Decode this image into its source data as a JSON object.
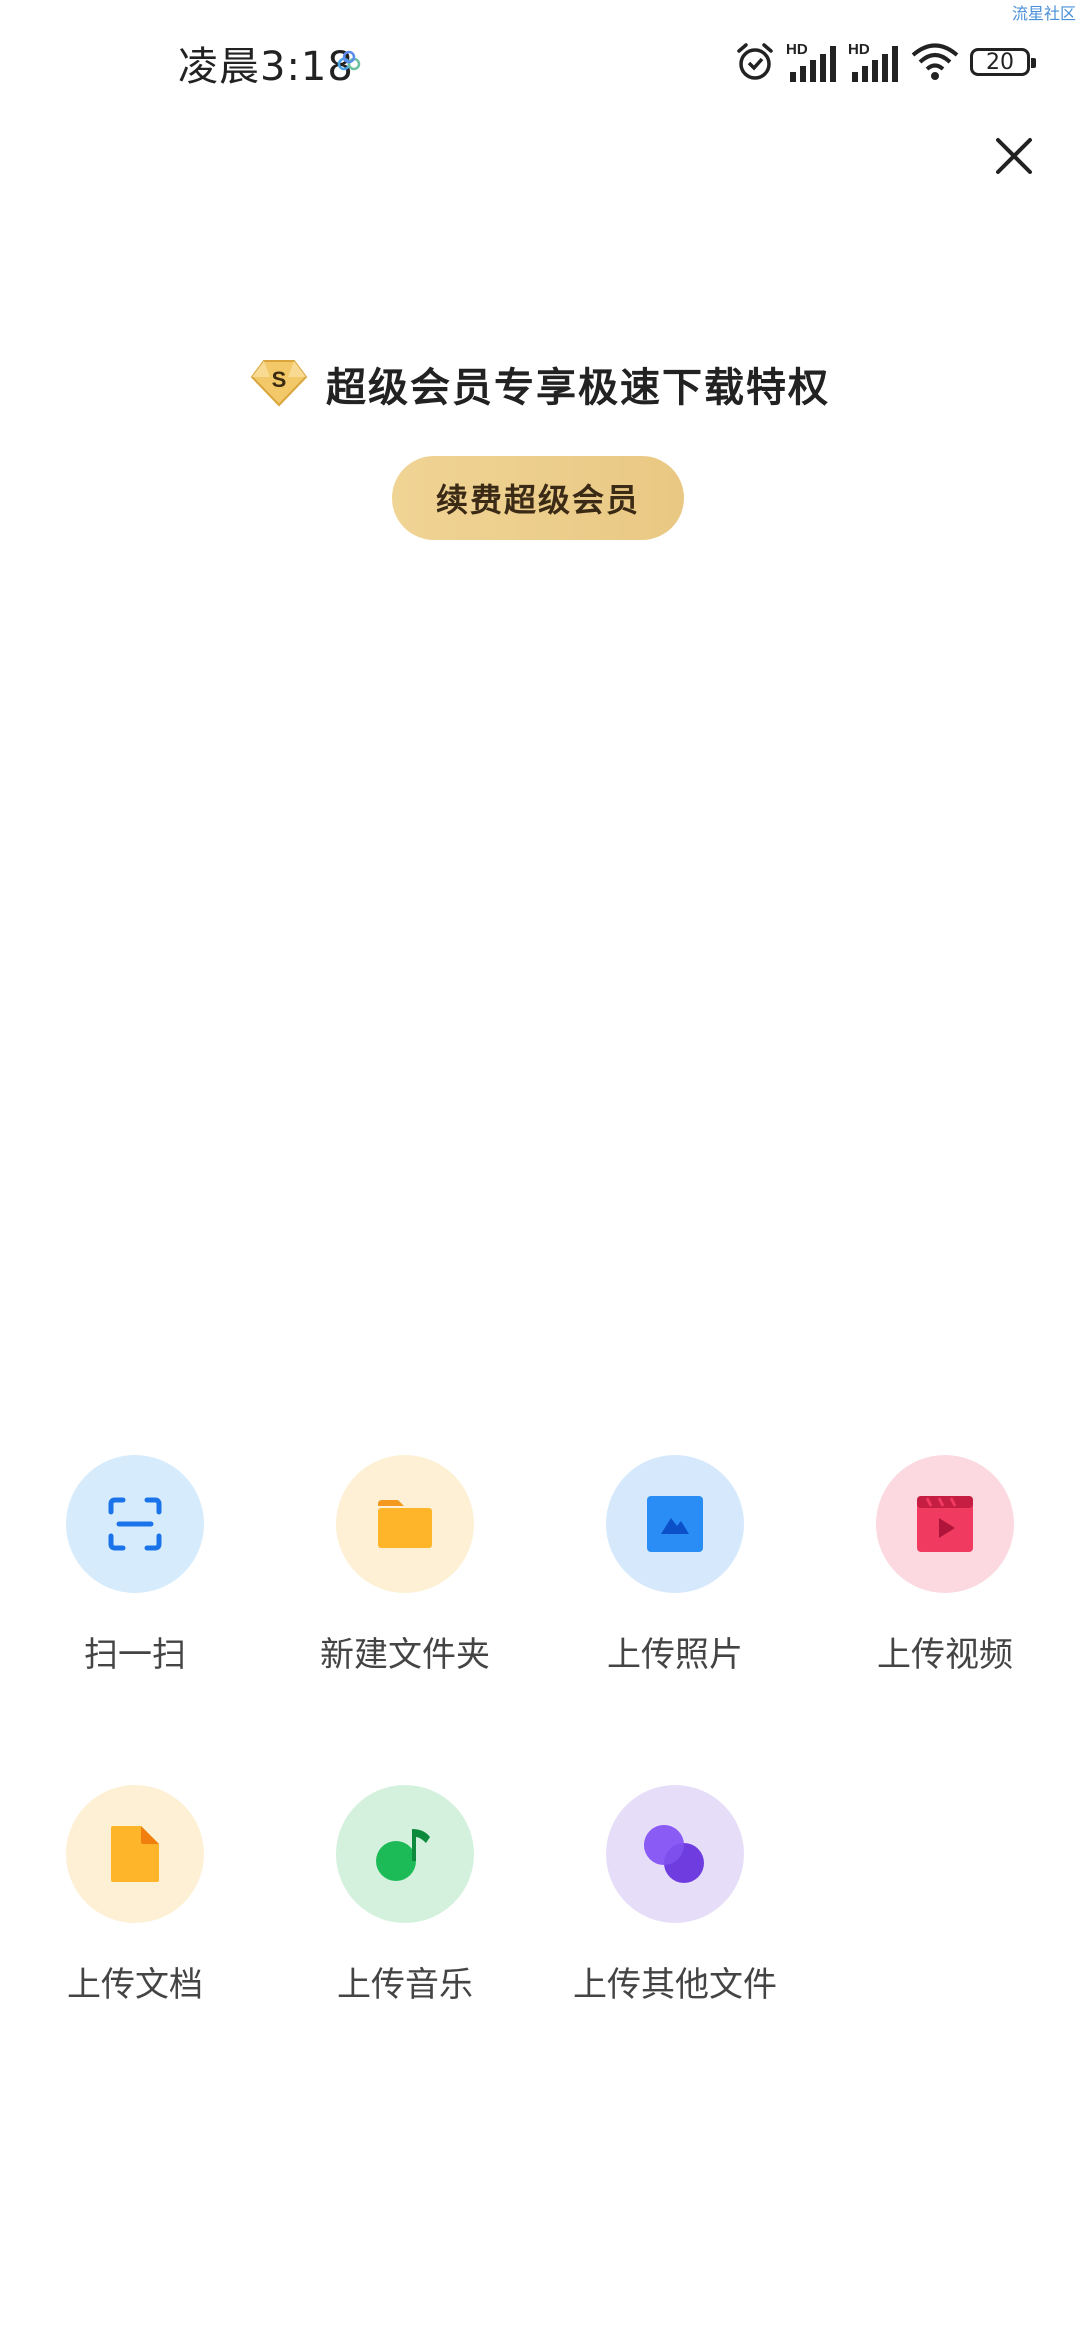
{
  "status_bar": {
    "time": "凌晨3:18",
    "battery": "20",
    "watermark": "流星社区",
    "signal_labels": [
      "HD",
      "HD"
    ]
  },
  "promo": {
    "badge_letter": "S",
    "title": "超级会员专享极速下载特权",
    "renew_button": "续费超级会员"
  },
  "actions": [
    {
      "label": "扫一扫",
      "icon": "scan-icon",
      "bg": "#d6ecfc",
      "color": "#1a73e8"
    },
    {
      "label": "新建文件夹",
      "icon": "folder-icon",
      "bg": "#fdf0d4",
      "color": "#ffb52a"
    },
    {
      "label": "上传照片",
      "icon": "photo-icon",
      "bg": "#d5e8fc",
      "color": "#2a8cf5"
    },
    {
      "label": "上传视频",
      "icon": "video-icon",
      "bg": "#fcd9e0",
      "color": "#f03a5f"
    },
    {
      "label": "上传文档",
      "icon": "document-icon",
      "bg": "#fdf0d4",
      "color": "#ffb52a"
    },
    {
      "label": "上传音乐",
      "icon": "music-icon",
      "bg": "#d3f1dd",
      "color": "#1dbb58"
    },
    {
      "label": "上传其他文件",
      "icon": "other-file-icon",
      "bg": "#e6def9",
      "color": "#8a5cf5"
    }
  ]
}
